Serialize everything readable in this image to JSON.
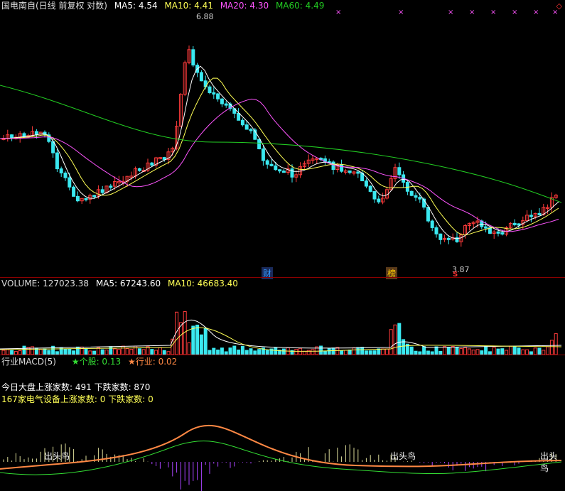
{
  "price": {
    "title": "国电南自(日线 前复权 对数)",
    "ma5_label": "MA5: 4.54",
    "ma10_label": "MA10: 4.41",
    "ma20_label": "MA20: 4.30",
    "ma60_label": "MA60: 4.49",
    "high_label": "6.88",
    "low_label": "3.87",
    "event_cai": "财",
    "event_bang": "榜",
    "event_s": "S"
  },
  "volume": {
    "label": "VOLUME: 127023.38",
    "ma5_label": "MA5: 67243.60",
    "ma10_label": "MA10: 46683.40"
  },
  "macd": {
    "title": "行业MACD(5)",
    "stock_label": "★个股: 0.13",
    "industry_label": "★行业: 0.02",
    "market_line": "今日大盘上涨家数: 491 下跌家数: 870",
    "sector_line": "167家电气设备上涨家数: 0 下跌家数: 0",
    "signal_1": "出头鸟",
    "signal_2": "出头鸟",
    "signal_3": "出头鸟"
  },
  "colors": {
    "up": "#ff3b3b",
    "down": "#3ae8f0",
    "ma5": "#ffffff",
    "ma10": "#ffff55",
    "ma20": "#ff55ff",
    "ma60": "#22cc22"
  }
}
